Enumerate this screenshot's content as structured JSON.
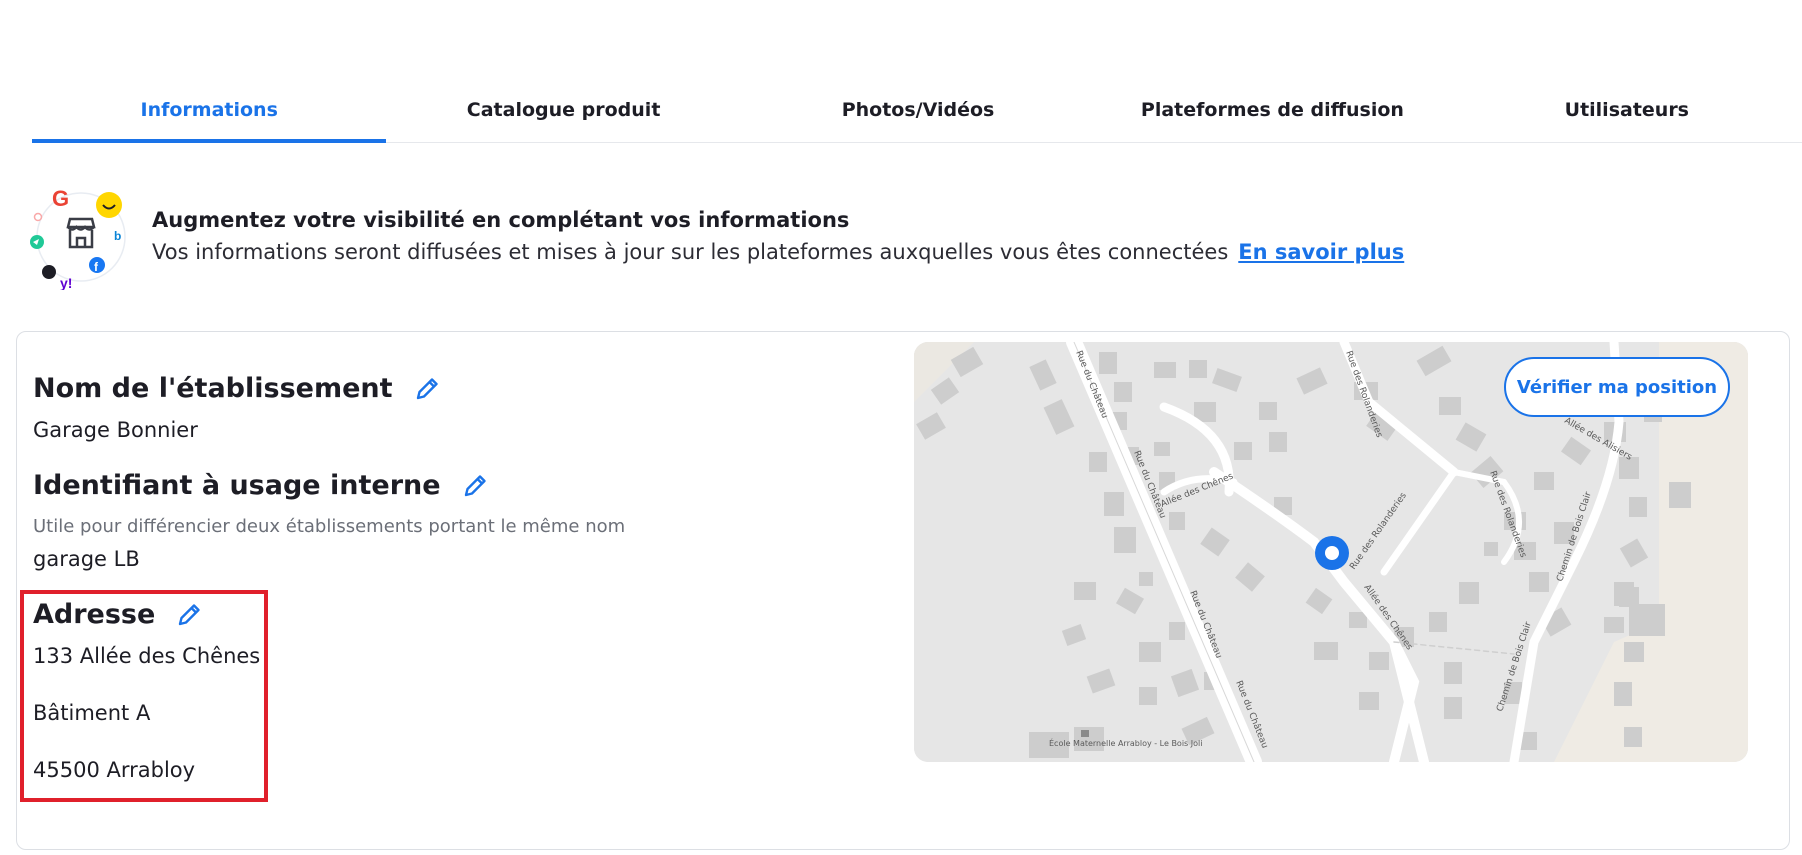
{
  "tabs": [
    {
      "label": "Informations",
      "active": true
    },
    {
      "label": "Catalogue produit"
    },
    {
      "label": "Photos/Vidéos"
    },
    {
      "label": "Plateformes de diffusion"
    },
    {
      "label": "Utilisateurs"
    }
  ],
  "banner": {
    "title": "Augmentez votre visibilité en complétant vos informations",
    "text": "Vos informations seront diffusées et mises à jour sur les plateformes auxquelles vous êtes connectées",
    "link": "En savoir plus"
  },
  "fields": {
    "name": {
      "title": "Nom de l'établissement",
      "value": "Garage Bonnier"
    },
    "internal_id": {
      "title": "Identifiant à usage interne",
      "help": "Utile pour différencier deux établissements portant le même nom",
      "value": "garage LB"
    },
    "address": {
      "title": "Adresse",
      "line1": "133 Allée des Chênes",
      "line2": "Bâtiment A",
      "line3": "45500 Arrabloy"
    }
  },
  "map": {
    "verify_button": "Vérifier ma position",
    "street_labels": [
      "Rue du Château",
      "Rue du Château",
      "Rue du Château",
      "Rue du Château",
      "Allée des Chênes",
      "Allée des Chênes",
      "Rue des Rolanderies",
      "Rue des Rolanderies",
      "Rue des Rolanderies",
      "Chemin de Bois Clair",
      "Chemin de Bois Clair",
      "Allée des Alisiers",
      "École Maternelle Arrabloy - Le Bois Joli"
    ]
  },
  "colors": {
    "accent": "#1a73e8",
    "highlight": "#e0202b"
  }
}
